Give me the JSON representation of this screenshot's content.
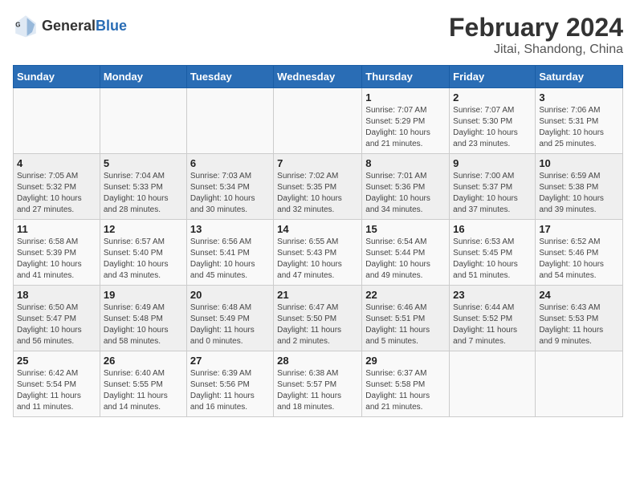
{
  "header": {
    "logo_general": "General",
    "logo_blue": "Blue",
    "main_title": "February 2024",
    "subtitle": "Jitai, Shandong, China"
  },
  "days_of_week": [
    "Sunday",
    "Monday",
    "Tuesday",
    "Wednesday",
    "Thursday",
    "Friday",
    "Saturday"
  ],
  "weeks": [
    [
      {
        "day": "",
        "info": ""
      },
      {
        "day": "",
        "info": ""
      },
      {
        "day": "",
        "info": ""
      },
      {
        "day": "",
        "info": ""
      },
      {
        "day": "1",
        "info": "Sunrise: 7:07 AM\nSunset: 5:29 PM\nDaylight: 10 hours\nand 21 minutes."
      },
      {
        "day": "2",
        "info": "Sunrise: 7:07 AM\nSunset: 5:30 PM\nDaylight: 10 hours\nand 23 minutes."
      },
      {
        "day": "3",
        "info": "Sunrise: 7:06 AM\nSunset: 5:31 PM\nDaylight: 10 hours\nand 25 minutes."
      }
    ],
    [
      {
        "day": "4",
        "info": "Sunrise: 7:05 AM\nSunset: 5:32 PM\nDaylight: 10 hours\nand 27 minutes."
      },
      {
        "day": "5",
        "info": "Sunrise: 7:04 AM\nSunset: 5:33 PM\nDaylight: 10 hours\nand 28 minutes."
      },
      {
        "day": "6",
        "info": "Sunrise: 7:03 AM\nSunset: 5:34 PM\nDaylight: 10 hours\nand 30 minutes."
      },
      {
        "day": "7",
        "info": "Sunrise: 7:02 AM\nSunset: 5:35 PM\nDaylight: 10 hours\nand 32 minutes."
      },
      {
        "day": "8",
        "info": "Sunrise: 7:01 AM\nSunset: 5:36 PM\nDaylight: 10 hours\nand 34 minutes."
      },
      {
        "day": "9",
        "info": "Sunrise: 7:00 AM\nSunset: 5:37 PM\nDaylight: 10 hours\nand 37 minutes."
      },
      {
        "day": "10",
        "info": "Sunrise: 6:59 AM\nSunset: 5:38 PM\nDaylight: 10 hours\nand 39 minutes."
      }
    ],
    [
      {
        "day": "11",
        "info": "Sunrise: 6:58 AM\nSunset: 5:39 PM\nDaylight: 10 hours\nand 41 minutes."
      },
      {
        "day": "12",
        "info": "Sunrise: 6:57 AM\nSunset: 5:40 PM\nDaylight: 10 hours\nand 43 minutes."
      },
      {
        "day": "13",
        "info": "Sunrise: 6:56 AM\nSunset: 5:41 PM\nDaylight: 10 hours\nand 45 minutes."
      },
      {
        "day": "14",
        "info": "Sunrise: 6:55 AM\nSunset: 5:43 PM\nDaylight: 10 hours\nand 47 minutes."
      },
      {
        "day": "15",
        "info": "Sunrise: 6:54 AM\nSunset: 5:44 PM\nDaylight: 10 hours\nand 49 minutes."
      },
      {
        "day": "16",
        "info": "Sunrise: 6:53 AM\nSunset: 5:45 PM\nDaylight: 10 hours\nand 51 minutes."
      },
      {
        "day": "17",
        "info": "Sunrise: 6:52 AM\nSunset: 5:46 PM\nDaylight: 10 hours\nand 54 minutes."
      }
    ],
    [
      {
        "day": "18",
        "info": "Sunrise: 6:50 AM\nSunset: 5:47 PM\nDaylight: 10 hours\nand 56 minutes."
      },
      {
        "day": "19",
        "info": "Sunrise: 6:49 AM\nSunset: 5:48 PM\nDaylight: 10 hours\nand 58 minutes."
      },
      {
        "day": "20",
        "info": "Sunrise: 6:48 AM\nSunset: 5:49 PM\nDaylight: 11 hours\nand 0 minutes."
      },
      {
        "day": "21",
        "info": "Sunrise: 6:47 AM\nSunset: 5:50 PM\nDaylight: 11 hours\nand 2 minutes."
      },
      {
        "day": "22",
        "info": "Sunrise: 6:46 AM\nSunset: 5:51 PM\nDaylight: 11 hours\nand 5 minutes."
      },
      {
        "day": "23",
        "info": "Sunrise: 6:44 AM\nSunset: 5:52 PM\nDaylight: 11 hours\nand 7 minutes."
      },
      {
        "day": "24",
        "info": "Sunrise: 6:43 AM\nSunset: 5:53 PM\nDaylight: 11 hours\nand 9 minutes."
      }
    ],
    [
      {
        "day": "25",
        "info": "Sunrise: 6:42 AM\nSunset: 5:54 PM\nDaylight: 11 hours\nand 11 minutes."
      },
      {
        "day": "26",
        "info": "Sunrise: 6:40 AM\nSunset: 5:55 PM\nDaylight: 11 hours\nand 14 minutes."
      },
      {
        "day": "27",
        "info": "Sunrise: 6:39 AM\nSunset: 5:56 PM\nDaylight: 11 hours\nand 16 minutes."
      },
      {
        "day": "28",
        "info": "Sunrise: 6:38 AM\nSunset: 5:57 PM\nDaylight: 11 hours\nand 18 minutes."
      },
      {
        "day": "29",
        "info": "Sunrise: 6:37 AM\nSunset: 5:58 PM\nDaylight: 11 hours\nand 21 minutes."
      },
      {
        "day": "",
        "info": ""
      },
      {
        "day": "",
        "info": ""
      }
    ]
  ]
}
